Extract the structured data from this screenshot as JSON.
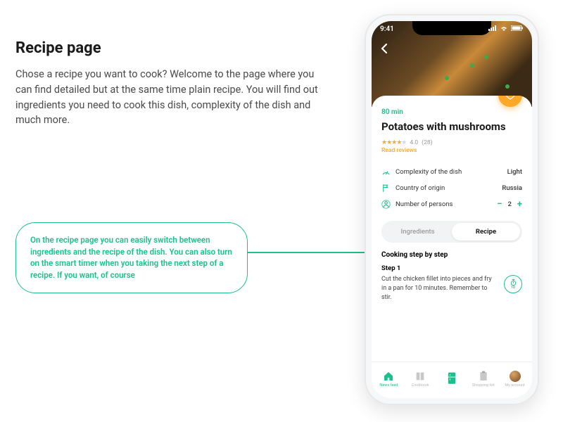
{
  "left": {
    "title": "Recipe page",
    "description": "Chose a recipe you want to cook? Welcome to the page where you can find detailed but at the same time plain recipe. You will find out ingredients you need to cook this dish, complexity of the dish and much more."
  },
  "callout": {
    "text": "On the recipe page you can easily switch between ingredients and the recipe of the dish. You can also turn on the smart timer when you taking the next step of a recipe. If you want, of course"
  },
  "phone": {
    "status_time": "9:41",
    "hero_alt": "Potatoes with mushrooms dish",
    "cook_time": "80 min",
    "title": "Potatoes with mushrooms",
    "rating_value": "4.0",
    "rating_count": "(28)",
    "read_reviews": "Read reviews",
    "meta": {
      "complexity_label": "Complexity of the dish",
      "complexity_value": "Light",
      "country_label": "Country of origin",
      "country_value": "Russia",
      "persons_label": "Number of persons",
      "persons_value": "2"
    },
    "tabs": {
      "ingredients": "Ingredients",
      "recipe": "Recipe"
    },
    "steps": {
      "heading": "Cooking step by step",
      "step1_label": "Step 1",
      "step1_text": "Cut the chicken fillet into pieces and fry in a pan for 10 minutes. Remember to stir.",
      "step1_timer": "10"
    },
    "nav": {
      "news": "News feed",
      "cookbook": "Cookbook",
      "add": "",
      "shopping": "Shopping list",
      "account": "My account"
    }
  }
}
